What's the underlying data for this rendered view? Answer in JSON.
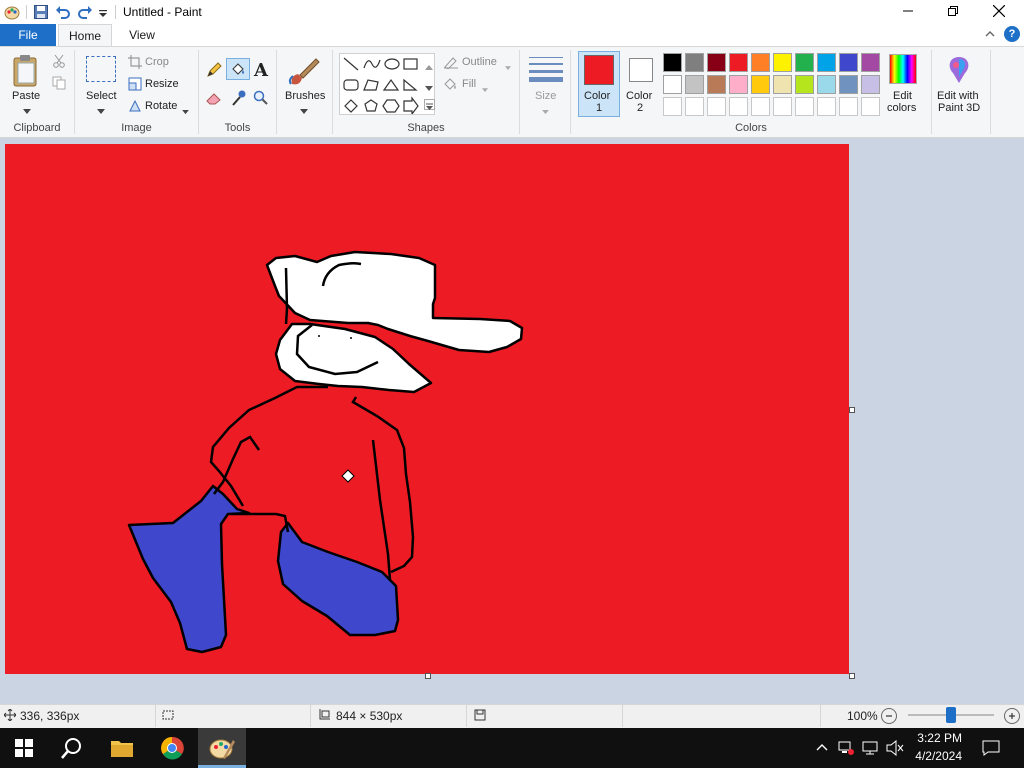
{
  "window": {
    "title": "Untitled - Paint",
    "controls": [
      "minimize",
      "maximize",
      "close"
    ]
  },
  "tabs": [
    {
      "label": "File",
      "active": false
    },
    {
      "label": "Home",
      "active": true
    },
    {
      "label": "View",
      "active": false
    }
  ],
  "ribbon": {
    "clipboard": {
      "label": "Clipboard",
      "paste": "Paste"
    },
    "image": {
      "label": "Image",
      "select": "Select",
      "crop": "Crop",
      "resize": "Resize",
      "rotate": "Rotate"
    },
    "tools": {
      "label": "Tools"
    },
    "brushes": {
      "label": "Brushes"
    },
    "shapes": {
      "label": "Shapes",
      "outline": "Outline",
      "fill": "Fill"
    },
    "size": {
      "label": "Size"
    },
    "colors": {
      "label": "Colors",
      "color1_line1": "Color",
      "color1_line2": "1",
      "color2_line1": "Color",
      "color2_line2": "2",
      "color1_value": "#ed1c24",
      "color2_value": "#ffffff",
      "edit_colors_line1": "Edit",
      "edit_colors_line2": "colors",
      "palette_row1": [
        "#000000",
        "#7f7f7f",
        "#880015",
        "#ed1c24",
        "#ff7f27",
        "#fff200",
        "#22b14c",
        "#00a2e8",
        "#3f48cc",
        "#a349a4"
      ],
      "palette_row2": [
        "#ffffff",
        "#c3c3c3",
        "#b97a57",
        "#ffaec9",
        "#ffc90e",
        "#efe4b0",
        "#b5e61d",
        "#99d9ea",
        "#7092be",
        "#c8bfe7"
      ]
    },
    "paint3d": {
      "line1": "Edit with",
      "line2": "Paint 3D"
    }
  },
  "canvas": {
    "background": "#ed1c24",
    "drawing_fill_blue": "#3f48cc",
    "drawing_fill_white": "#ffffff"
  },
  "statusbar": {
    "cursor_position": "336, 336px",
    "selection_size": "",
    "image_size": "844 × 530px",
    "zoom": "100%"
  },
  "taskbar": {
    "time": "3:22 PM",
    "date": "4/2/2024"
  }
}
